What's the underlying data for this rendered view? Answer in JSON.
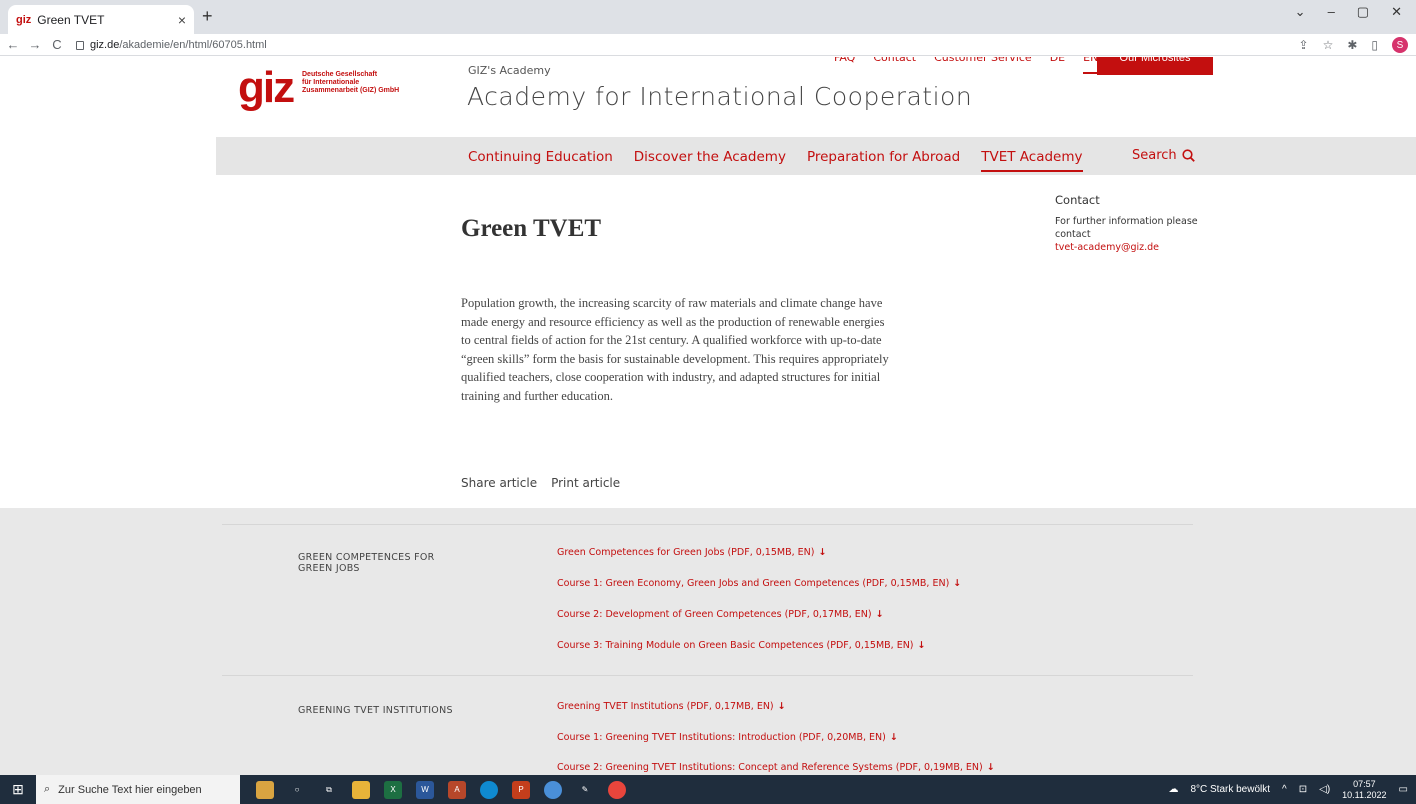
{
  "browser": {
    "tab_favicon": "giz",
    "tab_title": "Green TVET",
    "tab_close": "×",
    "new_tab": "+",
    "url_domain": "giz.de",
    "url_path": "/akademie/en/html/60705.html",
    "profile_initial": "S",
    "win_controls": [
      "⌄",
      "–",
      "▢",
      "✕"
    ],
    "toolbar_icons": [
      "share-icon",
      "star-icon",
      "extensions-icon",
      "sidebar-icon"
    ]
  },
  "logo": {
    "mark": "giz",
    "line1": "Deutsche Gesellschaft",
    "line2": "für Internationale",
    "line3": "Zusammenarbeit (GIZ) GmbH"
  },
  "util_nav": [
    "FAQ",
    "Contact",
    "Customer Service",
    "DE",
    "EN"
  ],
  "microsites_label": "Our Microsites",
  "academy": {
    "small": "GIZ's Academy",
    "title": "Academy for International Cooperation"
  },
  "main_nav": [
    "Continuing Education",
    "Discover the Academy",
    "Preparation for Abroad",
    "TVET Academy"
  ],
  "search_label": "Search",
  "contact": {
    "title": "Contact",
    "text": "For further information please contact",
    "email": "tvet-academy@giz.de"
  },
  "page_title": "Green TVET",
  "intro": "Population growth, the increasing scarcity of raw materials and climate change have made energy and resource efficiency as well as the production of renewable energies to central fields of action for the 21st century. A qualified workforce with up-to-date “green skills” form the basis for sustainable development. This requires appropriately qualified teachers, close cooperation with industry, and adapted structures for initial training and further education.",
  "share": {
    "share_label": "Share article",
    "print_label": "Print article"
  },
  "downloads": {
    "group1": {
      "label": "GREEN COMPETENCES FOR GREEN JOBS",
      "links": [
        "Green Competences for Green Jobs (PDF, 0,15MB, EN)",
        "Course 1: Green Economy, Green Jobs and Green Competences (PDF, 0,15MB, EN)",
        "Course 2: Development of Green Competences (PDF, 0,17MB, EN)",
        "Course 3: Training Module on Green Basic Competences (PDF, 0,15MB, EN)"
      ]
    },
    "group2": {
      "label": "GREENING TVET INSTITUTIONS",
      "links": [
        "Greening TVET Institutions (PDF, 0,17MB, EN)",
        "Course 1: Greening TVET Institutions: Introduction (PDF, 0,20MB, EN)",
        "Course 2: Greening TVET Institutions: Concept and Reference Systems (PDF, 0,19MB, EN)"
      ]
    },
    "arrow": "↓"
  },
  "taskbar": {
    "search_placeholder": "Zur Suche Text hier eingeben",
    "weather": "8°C Stark bewölkt",
    "time": "07:57",
    "date": "10.11.2022"
  },
  "colors": {
    "brand_red": "#c30f0f",
    "gray_band": "#e5e5e5",
    "taskbar": "#1f2d3d"
  }
}
